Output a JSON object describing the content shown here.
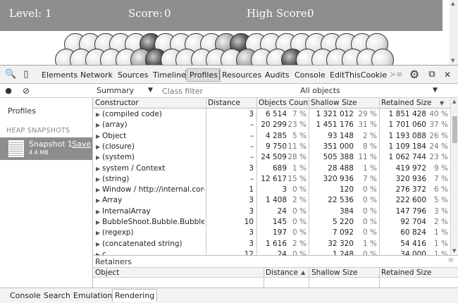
{
  "game": {
    "level_label": "Level:",
    "level_value": "1",
    "score_label": "Score:",
    "score_value": "0",
    "high_score_label": "High Score:",
    "high_score_value": "0"
  },
  "devtools": {
    "tabs": [
      "Elements",
      "Network",
      "Sources",
      "Timeline",
      "Profiles",
      "Resources",
      "Audits",
      "Console",
      "EditThisCookie"
    ],
    "active_tab": "Profiles",
    "view_select": "Summary",
    "class_filter_placeholder": "Class filter",
    "objects_select": "All objects",
    "left_panel": {
      "title": "Profiles",
      "section_header": "HEAP SNAPSHOTS",
      "snapshot_name": "Snapshot 1",
      "snapshot_save": "Save",
      "snapshot_size": "4.4 MB"
    },
    "grid": {
      "columns": [
        "Constructor",
        "Distance",
        "Objects Count",
        "Shallow Size",
        "Retained Size"
      ],
      "rows": [
        {
          "name": "(compiled code)",
          "distance": "3",
          "count": "6 514",
          "count_pct": "7 %",
          "shallow": "1 321 012",
          "shallow_pct": "29 %",
          "retained": "1 851 428",
          "retained_pct": "40 %"
        },
        {
          "name": "(array)",
          "distance": "–",
          "count": "20 299",
          "count_pct": "23 %",
          "shallow": "1 451 176",
          "shallow_pct": "31 %",
          "retained": "1 701 060",
          "retained_pct": "37 %"
        },
        {
          "name": "Object",
          "distance": "–",
          "count": "4 285",
          "count_pct": "5 %",
          "shallow": "93 148",
          "shallow_pct": "2 %",
          "retained": "1 193 088",
          "retained_pct": "26 %"
        },
        {
          "name": "(closure)",
          "distance": "–",
          "count": "9 750",
          "count_pct": "11 %",
          "shallow": "351 000",
          "shallow_pct": "8 %",
          "retained": "1 109 184",
          "retained_pct": "24 %"
        },
        {
          "name": "(system)",
          "distance": "–",
          "count": "24 509",
          "count_pct": "28 %",
          "shallow": "505 388",
          "shallow_pct": "11 %",
          "retained": "1 062 744",
          "retained_pct": "23 %"
        },
        {
          "name": "system / Context",
          "distance": "3",
          "count": "689",
          "count_pct": "1 %",
          "shallow": "28 488",
          "shallow_pct": "1 %",
          "retained": "419 972",
          "retained_pct": "9 %"
        },
        {
          "name": "(string)",
          "distance": "–",
          "count": "12 617",
          "count_pct": "15 %",
          "shallow": "320 936",
          "shallow_pct": "7 %",
          "retained": "320 936",
          "retained_pct": "7 %"
        },
        {
          "name": "Window / http://internal.core...",
          "distance": "1",
          "count": "3",
          "count_pct": "0 %",
          "shallow": "120",
          "shallow_pct": "0 %",
          "retained": "276 372",
          "retained_pct": "6 %"
        },
        {
          "name": "Array",
          "distance": "3",
          "count": "1 408",
          "count_pct": "2 %",
          "shallow": "22 536",
          "shallow_pct": "0 %",
          "retained": "222 600",
          "retained_pct": "5 %"
        },
        {
          "name": "InternalArray",
          "distance": "3",
          "count": "24",
          "count_pct": "0 %",
          "shallow": "384",
          "shallow_pct": "0 %",
          "retained": "147 796",
          "retained_pct": "3 %"
        },
        {
          "name": "BubbleShoot.Bubble.Bubble",
          "distance": "10",
          "count": "145",
          "count_pct": "0 %",
          "shallow": "5 220",
          "shallow_pct": "0 %",
          "retained": "92 704",
          "retained_pct": "2 %"
        },
        {
          "name": "(regexp)",
          "distance": "3",
          "count": "197",
          "count_pct": "0 %",
          "shallow": "7 092",
          "shallow_pct": "0 %",
          "retained": "60 824",
          "retained_pct": "1 %"
        },
        {
          "name": "(concatenated string)",
          "distance": "3",
          "count": "1 616",
          "count_pct": "2 %",
          "shallow": "32 320",
          "shallow_pct": "1 %",
          "retained": "54 416",
          "retained_pct": "1 %"
        },
        {
          "name": "c",
          "distance": "12",
          "count": "24",
          "count_pct": "0 %",
          "shallow": "1 248",
          "shallow_pct": "0 %",
          "retained": "34 000",
          "retained_pct": "1 %"
        }
      ]
    },
    "retainers": {
      "title": "Retainers",
      "columns": [
        "Object",
        "Distance",
        "Shallow Size",
        "Retained Size"
      ]
    },
    "drawer_tabs": [
      "Console",
      "Search",
      "Emulation",
      "Rendering"
    ],
    "active_drawer_tab": "Rendering"
  }
}
